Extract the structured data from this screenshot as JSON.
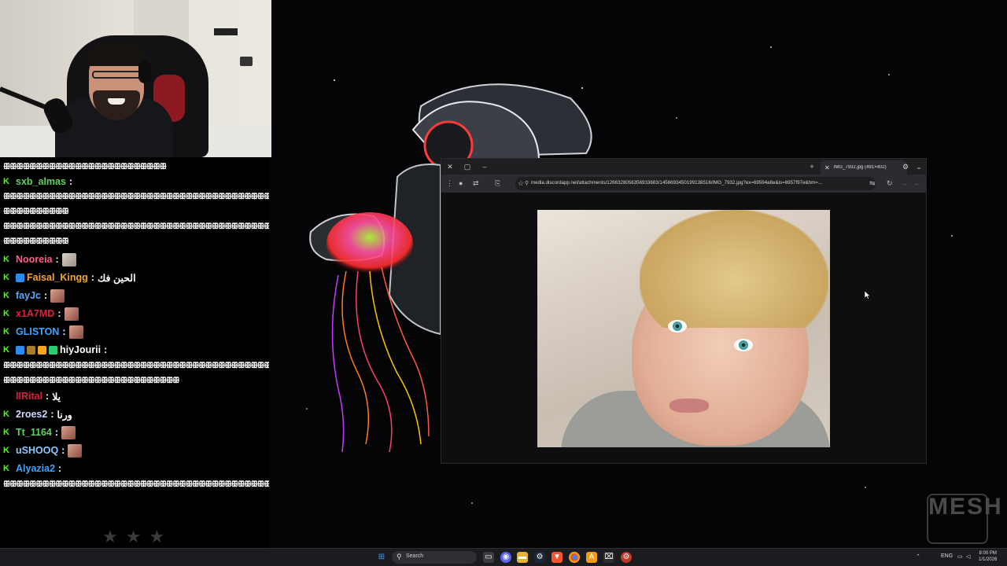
{
  "chat": {
    "messages": [
      {
        "user": "",
        "user_color": "#ffffff",
        "text": "ꕥꕥꕥꕥꕥꕥꕥꕥꕥꕥꕥꕥꕥꕥꕥꕥꕥꕥꕥꕥꕥꕥꕥꕥꕥ",
        "kind": "spam"
      },
      {
        "user": "sxb_almas",
        "user_color": "#5fd35f",
        "text": "",
        "kind": "msg"
      },
      {
        "user": "",
        "user_color": "#ffffff",
        "text": "ꕥꕥꕥꕥꕥꕥꕥꕥꕥꕥꕥꕥꕥꕥꕥꕥꕥꕥꕥꕥꕥꕥꕥꕥꕥꕥꕥꕥꕥꕥꕥꕥꕥꕥꕥꕥꕥꕥꕥꕥꕥꕥꕥꕥꕥꕥꕥꕥꕥꕥꕥꕥꕥꕥꕥꕥ",
        "kind": "spam"
      },
      {
        "user": "",
        "user_color": "#ffffff",
        "text": "ꕥꕥꕥꕥꕥꕥꕥꕥꕥꕥ",
        "kind": "spam"
      },
      {
        "user": "",
        "user_color": "#ffffff",
        "text": "ꕥꕥꕥꕥꕥꕥꕥꕥꕥꕥꕥꕥꕥꕥꕥꕥꕥꕥꕥꕥꕥꕥꕥꕥꕥꕥꕥꕥꕥꕥꕥꕥꕥꕥꕥꕥꕥꕥꕥꕥꕥꕥꕥꕥꕥꕥꕥꕥꕥꕥꕥꕥꕥꕥꕥꕥ",
        "kind": "spam"
      },
      {
        "user": "",
        "user_color": "#ffffff",
        "text": "ꕥꕥꕥꕥꕥꕥꕥꕥꕥꕥ",
        "kind": "spam"
      },
      {
        "user": "Nooreia",
        "user_color": "#ff5a8a",
        "text": "",
        "kind": "emote_pale"
      },
      {
        "user": "Faisal_Kingg",
        "user_color": "#f5a623",
        "text": "الحين فك",
        "kind": "msg_badge"
      },
      {
        "user": "fayJc",
        "user_color": "#5aa9ff",
        "text": "",
        "kind": "emote"
      },
      {
        "user": "x1A7MD",
        "user_color": "#e0203a",
        "text": "",
        "kind": "emote"
      },
      {
        "user": "GLISTON",
        "user_color": "#3da5ff",
        "text": "",
        "kind": "emote"
      },
      {
        "user": "hiyJourii",
        "user_color": "#ffffff",
        "text": "",
        "kind": "msg_multibadge"
      },
      {
        "user": "",
        "user_color": "#ffffff",
        "text": "ꕥꕥꕥꕥꕥꕥꕥꕥꕥꕥꕥꕥꕥꕥꕥꕥꕥꕥꕥꕥꕥꕥꕥꕥꕥꕥꕥꕥꕥꕥꕥꕥꕥꕥꕥꕥꕥꕥꕥꕥꕥꕥꕥꕥꕥꕥꕥꕥꕥꕥꕥꕥꕥꕥꕥꕥ",
        "kind": "spam"
      },
      {
        "user": "",
        "user_color": "#ffffff",
        "text": "ꕥꕥꕥꕥꕥꕥꕥꕥꕥꕥꕥꕥꕥꕥꕥꕥꕥꕥꕥꕥꕥꕥꕥꕥꕥꕥꕥ",
        "kind": "spam"
      },
      {
        "user": "lIRital",
        "user_color": "#e0203a",
        "text": "يلا",
        "kind": "msg_nobadge"
      },
      {
        "user": "2roes2",
        "user_color": "#cfd8ff",
        "text": "ورنا",
        "kind": "msg"
      },
      {
        "user": "Tt_1164",
        "user_color": "#5fd35f",
        "text": "",
        "kind": "emote"
      },
      {
        "user": "uSHOOQ",
        "user_color": "#8fc8ff",
        "text": "",
        "kind": "emote"
      },
      {
        "user": "Alyazia2",
        "user_color": "#3da5ff",
        "text": "",
        "kind": "msg"
      },
      {
        "user": "",
        "user_color": "#ffffff",
        "text": "ꕥꕥꕥꕥꕥꕥꕥꕥꕥꕥꕥꕥꕥꕥꕥꕥꕥꕥꕥꕥꕥꕥꕥꕥꕥꕥꕥꕥꕥꕥꕥꕥꕥꕥꕥꕥꕥꕥꕥꕥꕥꕥꕥꕥꕥꕥꕥꕥ",
        "kind": "spam"
      }
    ],
    "rating_stars": "★★★",
    "badge_color": "#53fc18"
  },
  "browser": {
    "tab_title": "IMG_7932.jpg (491×402)",
    "address": "media.discordapp.net/attachments/1266328056356933683/1456693450199138516/IMG_7932.jpg?ex=69594a6e&is=6957f97e&hm=...",
    "image_alt": "IMG_7932.jpg"
  },
  "watermark": {
    "text": "MESH"
  },
  "taskbar": {
    "search_placeholder": "Search",
    "lang": "ENG",
    "time": "8:00 PM",
    "date": "1/1/2026"
  }
}
